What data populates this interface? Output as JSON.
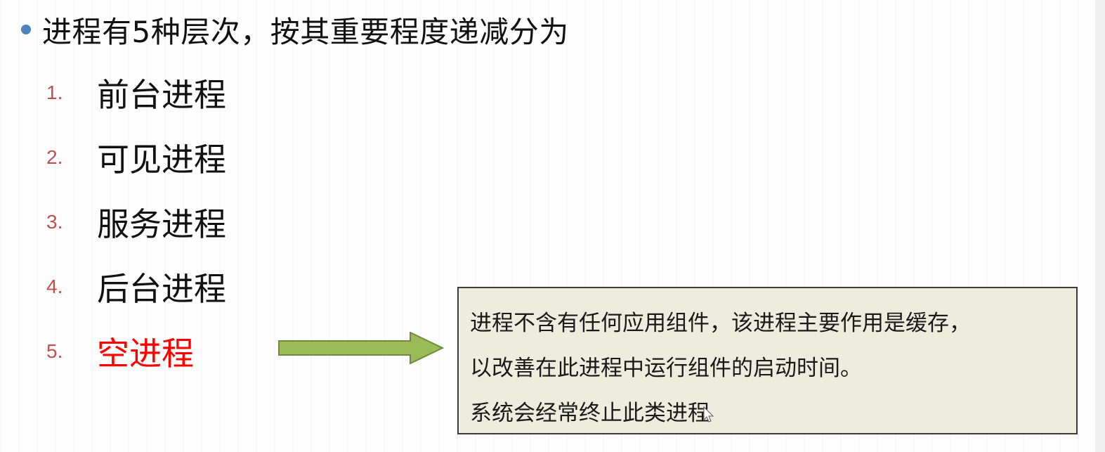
{
  "heading": {
    "text": "进程有5种层次，按其重要程度递减分为"
  },
  "list": [
    {
      "number": "1.",
      "label": "前台进程"
    },
    {
      "number": "2.",
      "label": "可见进程"
    },
    {
      "number": "3.",
      "label": "服务进程"
    },
    {
      "number": "4.",
      "label": "后台进程"
    },
    {
      "number": "5.",
      "label": "空进程"
    }
  ],
  "callout": {
    "lines": [
      "进程不含有任何应用组件，该进程主要作用是缓存，",
      "以改善在此进程中运行组件的启动时间。",
      "系统会经常终止此类进程"
    ]
  },
  "colors": {
    "bullet": "#4f81bd",
    "list_number": "#c0504d",
    "highlight": "#ff0000",
    "arrow_fill": "#9bbb59",
    "callout_bg": "#ecedde"
  },
  "icons": {
    "bullet": "bullet-dot-icon",
    "arrow": "right-arrow-icon",
    "cursor": "mouse-cursor-icon"
  }
}
